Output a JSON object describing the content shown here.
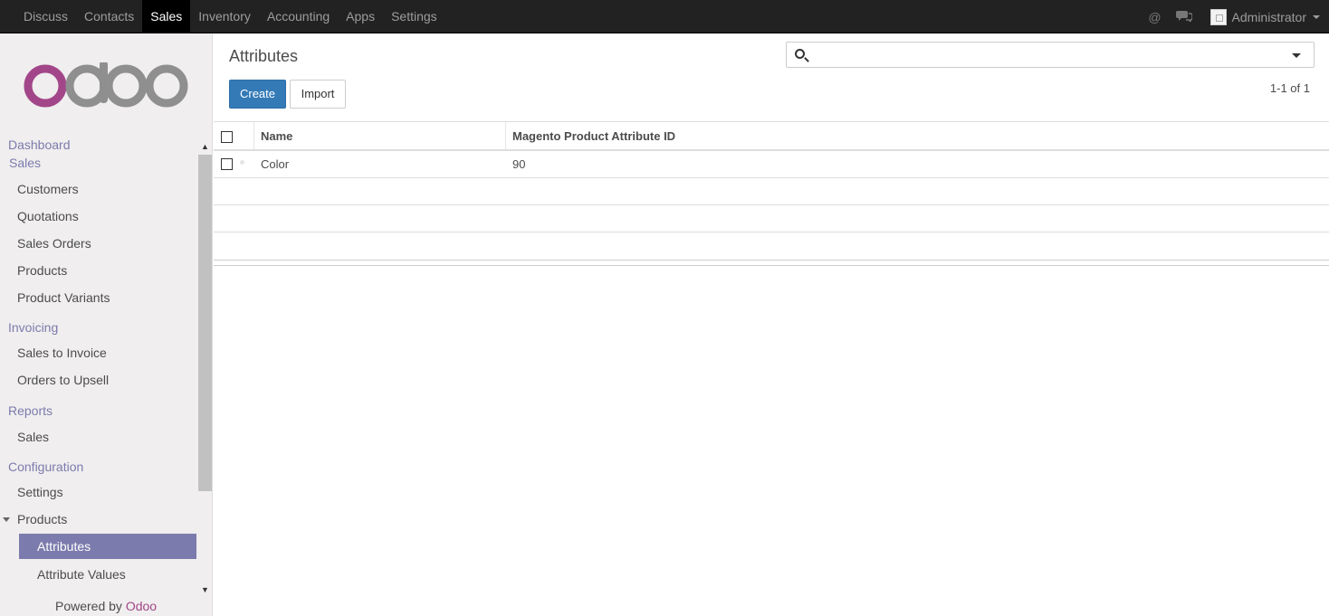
{
  "topbar": {
    "menu": [
      {
        "label": "Discuss"
      },
      {
        "label": "Contacts"
      },
      {
        "label": "Sales"
      },
      {
        "label": "Inventory"
      },
      {
        "label": "Accounting"
      },
      {
        "label": "Apps"
      },
      {
        "label": "Settings"
      }
    ],
    "active_menu": "Sales",
    "user": "Administrator",
    "icons": [
      "at-icon",
      "chat-icon"
    ]
  },
  "sidebar": {
    "logo_text": "odoo",
    "sections": {
      "dashboard": "Dashboard",
      "sales": "Sales",
      "invoicing": "Invoicing",
      "reports": "Reports",
      "configuration": "Configuration"
    },
    "items": {
      "customers": "Customers",
      "quotations": "Quotations",
      "sales_orders": "Sales Orders",
      "products": "Products",
      "product_variants": "Product Variants",
      "sales_to_invoice": "Sales to Invoice",
      "orders_to_upsell": "Orders to Upsell",
      "reports_sales": "Sales",
      "settings": "Settings",
      "config_products": "Products",
      "attributes": "Attributes",
      "attribute_values": "Attribute Values"
    },
    "powered_by": "Powered by",
    "powered_brand": "Odoo"
  },
  "main": {
    "title": "Attributes",
    "create_label": "Create",
    "import_label": "Import",
    "pager": "1-1 of 1",
    "search_placeholder": "",
    "columns": [
      "Name",
      "Magento Product Attribute ID"
    ],
    "rows": [
      {
        "name": "Color",
        "magento_id": "90"
      }
    ]
  },
  "colors": {
    "accent": "#7c7bad",
    "primary": "#337ab7",
    "navbar": "#222222",
    "brand": "#a24689"
  }
}
